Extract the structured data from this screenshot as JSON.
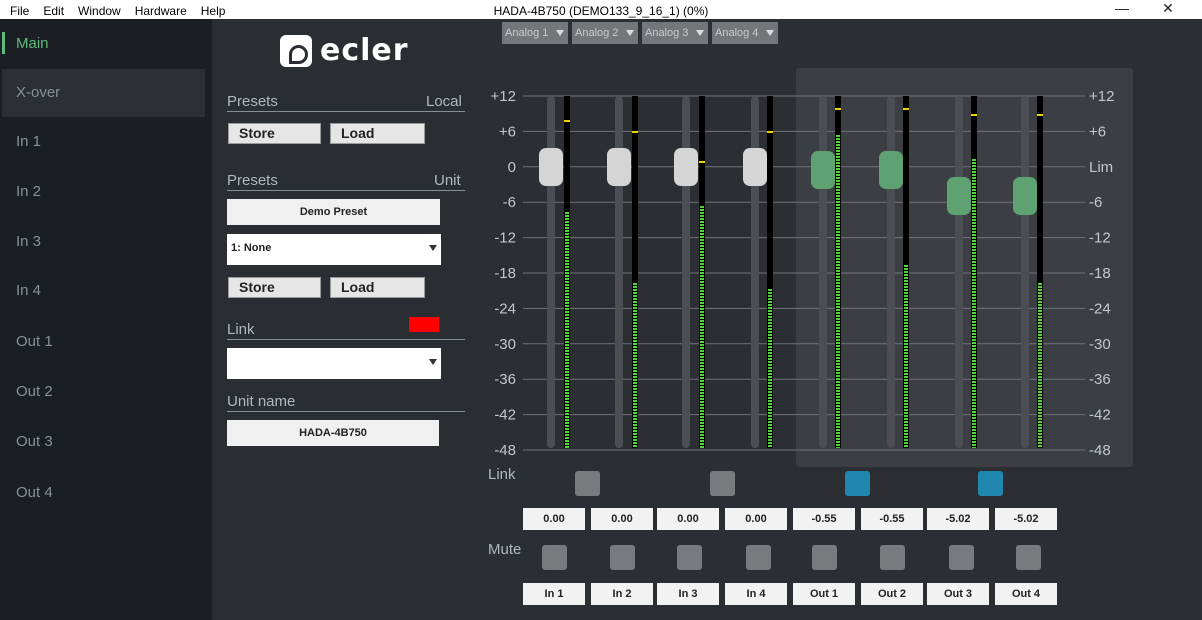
{
  "window": {
    "title": "HADA-4B750 (DEMO133_9_16_1) (0%)",
    "menu": [
      "File",
      "Edit",
      "Window",
      "Hardware",
      "Help"
    ],
    "minimize_glyph": "—",
    "close_glyph": "✕"
  },
  "nav": {
    "items": [
      {
        "label": "Main",
        "state": "active"
      },
      {
        "label": "X-over",
        "state": "hover"
      },
      {
        "label": "In 1"
      },
      {
        "label": "In 2"
      },
      {
        "label": "In 3"
      },
      {
        "label": "In 4"
      },
      {
        "label": "Out 1"
      },
      {
        "label": "Out 2"
      },
      {
        "label": "Out 3"
      },
      {
        "label": "Out 4"
      }
    ]
  },
  "panel": {
    "logo_text": "ecler",
    "presets_local_label": "Presets",
    "presets_local_right": "Local",
    "store_label": "Store",
    "load_label": "Load",
    "presets_unit_label": "Presets",
    "presets_unit_right": "Unit",
    "unit_preset_name": "Demo Preset",
    "unit_preset_select": "1: None",
    "link_label": "Link",
    "link_select_value": "",
    "link_color": "#ff0000",
    "unit_name_label": "Unit name",
    "unit_name_value": "HADA-4B750"
  },
  "mixer": {
    "sources": [
      "Analog 1",
      "Analog 2",
      "Analog 3",
      "Analog 4"
    ],
    "scale_left": [
      "+12",
      "+6",
      "0",
      "-6",
      "-12",
      "-18",
      "-24",
      "-30",
      "-36",
      "-42",
      "-48"
    ],
    "scale_right": [
      "+12",
      "+6",
      "Lim",
      "-6",
      "-12",
      "-18",
      "-24",
      "-30",
      "-36",
      "-42",
      "-48"
    ],
    "link_label": "Link",
    "mute_label": "Mute",
    "link_states": [
      false,
      false,
      true,
      true
    ],
    "colors": {
      "input_knob": "#d5d5d5",
      "output_knob": "#5fa272",
      "link_off": "#787b7e",
      "link_on": "#1f86ad",
      "meter": "#53d43a",
      "peak": "#f0d000"
    },
    "channels": [
      {
        "name": "In 1",
        "gain": "0.00",
        "fader_db": 0,
        "meter_db": -8,
        "peak_db": 8
      },
      {
        "name": "In 2",
        "gain": "0.00",
        "fader_db": 0,
        "meter_db": -20,
        "peak_db": 6
      },
      {
        "name": "In 3",
        "gain": "0.00",
        "fader_db": 0,
        "meter_db": -7,
        "peak_db": 1
      },
      {
        "name": "In 4",
        "gain": "0.00",
        "fader_db": 0,
        "meter_db": -21,
        "peak_db": 6
      },
      {
        "name": "Out 1",
        "gain": "-0.55",
        "fader_db": -0.55,
        "meter_db": 5,
        "peak_db": 10
      },
      {
        "name": "Out 2",
        "gain": "-0.55",
        "fader_db": -0.55,
        "meter_db": -17,
        "peak_db": 10
      },
      {
        "name": "Out 3",
        "gain": "-5.02",
        "fader_db": -5.02,
        "meter_db": 1,
        "peak_db": 9
      },
      {
        "name": "Out 4",
        "gain": "-5.02",
        "fader_db": -5.02,
        "meter_db": -20,
        "peak_db": 9
      }
    ]
  }
}
